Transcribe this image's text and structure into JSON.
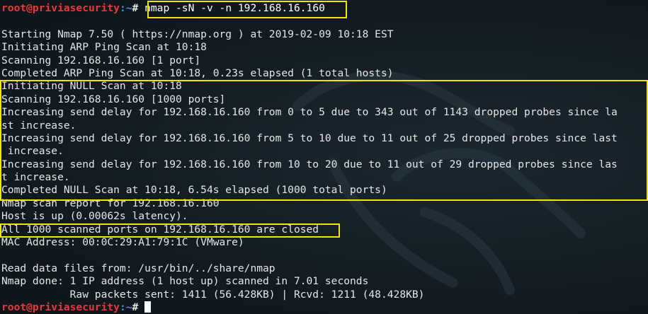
{
  "prompt": {
    "user_host": "root@priviasecurity",
    "path": ":~",
    "symbol": "# "
  },
  "command": "nmap -sN -v -n 192.168.16.160",
  "output_lines": [
    "",
    "Starting Nmap 7.50 ( https://nmap.org ) at 2019-02-09 10:18 EST",
    "Initiating ARP Ping Scan at 10:18",
    "Scanning 192.168.16.160 [1 port]",
    "Completed ARP Ping Scan at 10:18, 0.23s elapsed (1 total hosts)",
    "Initiating NULL Scan at 10:18",
    "Scanning 192.168.16.160 [1000 ports]",
    "Increasing send delay for 192.168.16.160 from 0 to 5 due to 343 out of 1143 dropped probes since la",
    "st increase.",
    "Increasing send delay for 192.168.16.160 from 5 to 10 due to 11 out of 25 dropped probes since last",
    " increase.",
    "Increasing send delay for 192.168.16.160 from 10 to 20 due to 11 out of 29 dropped probes since las",
    "t increase.",
    "Completed NULL Scan at 10:18, 6.54s elapsed (1000 total ports)",
    "Nmap scan report for 192.168.16.160",
    "Host is up (0.00062s latency).",
    "All 1000 scanned ports on 192.168.16.160 are closed",
    "MAC Address: 00:0C:29:A1:79:1C (VMware)",
    "",
    "Read data files from: /usr/bin/../share/nmap",
    "Nmap done: 1 IP address (1 host up) scanned in 7.01 seconds",
    "           Raw packets sent: 1411 (56.428KB) | Rcvd: 1211 (48.428KB)"
  ],
  "colors": {
    "prompt_user": "#e8383a",
    "prompt_path": "#4f8bd6",
    "highlight": "#f2e600",
    "background": "#121c22"
  }
}
